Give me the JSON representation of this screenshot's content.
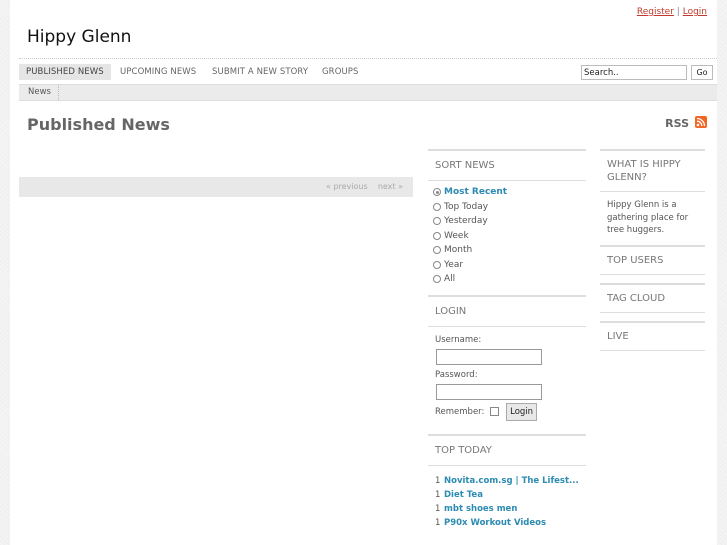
{
  "header": {
    "register_label": "Register",
    "separator": "|",
    "login_label": "Login",
    "site_title": "Hippy Glenn"
  },
  "nav": {
    "items": [
      {
        "label": "PUBLISHED NEWS",
        "active": true
      },
      {
        "label": "UPCOMING NEWS"
      },
      {
        "label": "SUBMIT A NEW STORY"
      },
      {
        "label": "GROUPS"
      }
    ],
    "search_value": "Search..",
    "search_button": "Go"
  },
  "subnav": {
    "tab_label": "News"
  },
  "main": {
    "heading": "Published News",
    "rss_label": "RSS",
    "pager": {
      "previous": "« previous",
      "next": "next »"
    }
  },
  "sort_news": {
    "title": "SORT NEWS",
    "options": [
      {
        "label": "Most Recent",
        "selected": true
      },
      {
        "label": "Top Today"
      },
      {
        "label": "Yesterday"
      },
      {
        "label": "Week"
      },
      {
        "label": "Month"
      },
      {
        "label": "Year"
      },
      {
        "label": "All"
      }
    ]
  },
  "login_box": {
    "title": "LOGIN",
    "username_label": "Username:",
    "password_label": "Password:",
    "remember_label": "Remember:",
    "button_label": "Login"
  },
  "top_today": {
    "title": "TOP TODAY",
    "items": [
      {
        "num": "1",
        "title": "Novita.com.sg | The Lifest..."
      },
      {
        "num": "1",
        "title": "Diet Tea"
      },
      {
        "num": "1",
        "title": "mbt shoes men"
      },
      {
        "num": "1",
        "title": "P90x Workout Videos"
      }
    ]
  },
  "right": {
    "about_title": "WHAT IS HIPPY GLENN?",
    "about_text": "Hippy Glenn is a gathering place for tree huggers.",
    "top_users": "TOP USERS",
    "tag_cloud": "TAG CLOUD",
    "live": "LIVE"
  },
  "colors": {
    "accent_link": "#2c8bb2",
    "header_link": "#c0392b",
    "rss_orange": "#f26522"
  }
}
